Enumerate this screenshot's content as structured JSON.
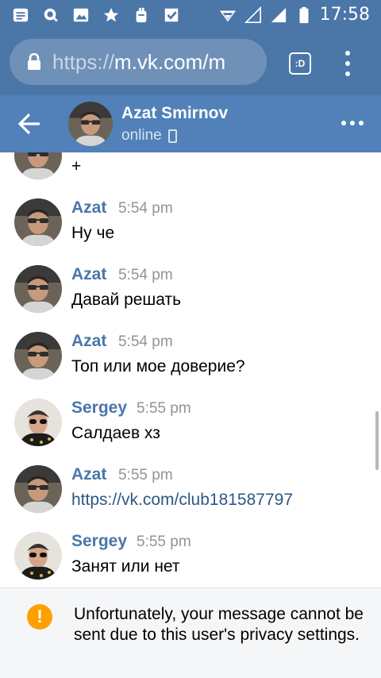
{
  "status_bar": {
    "time": "17:58",
    "icons": [
      "message-icon",
      "search-icon",
      "image-icon",
      "star-icon",
      "bug-icon",
      "check-icon",
      "wifi-icon",
      "signal-icon",
      "signal-icon",
      "battery-icon"
    ]
  },
  "browser": {
    "url_scheme": "https://",
    "url_host": "m.vk.com/m",
    "tabs_label": ":D"
  },
  "header": {
    "name": "Azat Smirnov",
    "status": "online"
  },
  "messages": [
    {
      "author": "",
      "time": "",
      "text": "+",
      "avatar": "azat"
    },
    {
      "author": "Azat",
      "time": "5:54 pm",
      "text": "Ну че",
      "avatar": "azat"
    },
    {
      "author": "Azat",
      "time": "5:54 pm",
      "text": "Давай решать",
      "avatar": "azat"
    },
    {
      "author": "Azat",
      "time": "5:54 pm",
      "text": "Топ или мое доверие?",
      "avatar": "azat"
    },
    {
      "author": "Sergey",
      "time": "5:55 pm",
      "text": "Салдаев хз",
      "avatar": "sergey"
    },
    {
      "author": "Azat",
      "time": "5:55 pm",
      "text": "https://vk.com/club181587797",
      "avatar": "azat",
      "is_link": true
    },
    {
      "author": "Sergey",
      "time": "5:55 pm",
      "text": "Занят или нет",
      "avatar": "sergey"
    }
  ],
  "notice": {
    "icon": "warning-icon",
    "text": "Unfortunately, your message cannot be sent due to this user's privacy settings."
  },
  "colors": {
    "header": "#5181b8",
    "status_bar": "#4a76a8",
    "author": "#4a76a8",
    "warning": "#ffa000"
  }
}
